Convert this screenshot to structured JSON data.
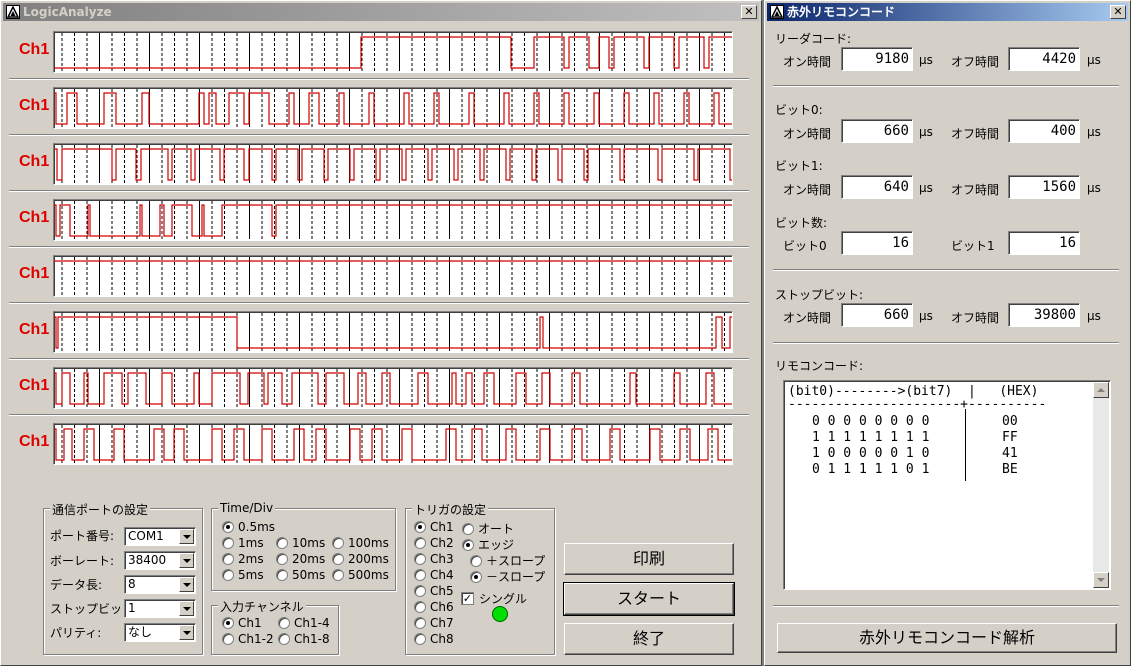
{
  "logic_window": {
    "title": "LogicAnalyze",
    "close_glyph": "✕",
    "channel_rows": [
      {
        "label": "Ch1",
        "edges": [
          0,
          307,
          457,
          480,
          510,
          515,
          535,
          545,
          555,
          560,
          590,
          595,
          620,
          625,
          650,
          655,
          680
        ]
      },
      {
        "label": "Ch1",
        "edges": [
          0,
          2,
          13,
          23,
          50,
          62,
          88,
          95,
          145,
          150,
          155,
          162,
          175,
          190,
          195,
          215,
          235,
          240,
          255,
          265,
          285,
          290,
          315,
          320,
          350,
          355,
          380,
          385,
          415,
          420,
          450,
          455,
          480,
          485,
          510,
          515,
          540,
          545,
          570,
          575,
          600,
          605,
          630,
          635,
          660,
          665,
          680
        ]
      },
      {
        "label": "Ch1",
        "edges": [
          0,
          3,
          8,
          58,
          62,
          82,
          87,
          114,
          118,
          137,
          141,
          166,
          170,
          190,
          195,
          218,
          222,
          244,
          248,
          270,
          274,
          296,
          300,
          322,
          326,
          348,
          352,
          374,
          378,
          400,
          404,
          426,
          430,
          452,
          456,
          478,
          482,
          504,
          508,
          530,
          534,
          566,
          570,
          604,
          608,
          640,
          644,
          676,
          680
        ]
      },
      {
        "label": "Ch1",
        "edges": [
          0,
          2,
          6,
          16,
          34,
          36,
          86,
          88,
          106,
          110,
          118,
          138,
          148,
          150,
          168,
          218,
          222,
          680
        ]
      },
      {
        "label": "Ch1",
        "edges": [
          0,
          680
        ]
      },
      {
        "label": "Ch1",
        "edges": [
          0,
          2,
          4,
          183,
          486,
          489,
          662,
          668,
          676,
          680
        ]
      },
      {
        "label": "Ch1",
        "edges": [
          0,
          2,
          8,
          16,
          30,
          34,
          50,
          68,
          74,
          92,
          108,
          118,
          140,
          145,
          158,
          186,
          194,
          210,
          214,
          228,
          238,
          264,
          272,
          290,
          304,
          312,
          328,
          336,
          364,
          374,
          398,
          402,
          412,
          418,
          430,
          440,
          462,
          472,
          488,
          496,
          518,
          526,
          576,
          582,
          620,
          626,
          652,
          660,
          680
        ]
      },
      {
        "label": "Ch1",
        "edges": [
          0,
          2,
          10,
          18,
          30,
          40,
          60,
          70,
          100,
          110,
          120,
          130,
          158,
          168,
          180,
          190,
          208,
          218,
          240,
          250,
          262,
          272,
          296,
          306,
          318,
          328,
          348,
          358,
          392,
          402,
          418,
          428,
          452,
          462,
          486,
          496,
          518,
          528,
          556,
          566,
          596,
          606,
          626,
          636,
          654,
          664,
          680
        ]
      }
    ],
    "port_settings": {
      "title": "通信ポートの設定",
      "port_label": "ポート番号:",
      "port_value": "COM1",
      "baud_label": "ボーレート:",
      "baud_value": "38400",
      "data_label": "データ長:",
      "data_value": "8",
      "stop_label": "ストップビット:",
      "stop_value": "1",
      "parity_label": "パリティ:",
      "parity_value": "なし"
    },
    "time_div": {
      "title": "Time/Div",
      "options": [
        "0.5ms",
        "1ms",
        "10ms",
        "100ms",
        "2ms",
        "20ms",
        "200ms",
        "5ms",
        "50ms",
        "500ms"
      ],
      "selected": "0.5ms"
    },
    "input_channel": {
      "title": "入力チャンネル",
      "options": [
        "Ch1",
        "Ch1-4",
        "Ch1-2",
        "Ch1-8"
      ],
      "selected": "Ch1"
    },
    "trigger": {
      "title": "トリガの設定",
      "channels": [
        "Ch1",
        "Ch2",
        "Ch3",
        "Ch4",
        "Ch5",
        "Ch6",
        "Ch7",
        "Ch8"
      ],
      "selected_channel": "Ch1",
      "auto_label": "オート",
      "edge_label": "エッジ",
      "mode_selected": "edge",
      "plus_slope_label": "＋スロープ",
      "minus_slope_label": "－スロープ",
      "slope_selected": "minus",
      "single_label": "シングル",
      "single_checked": true,
      "indicator_color": "#00e000"
    },
    "buttons": {
      "print": "印刷",
      "start": "スタート",
      "end": "終了"
    }
  },
  "remote_window": {
    "title": "赤外リモコンコード",
    "close_glyph": "✕",
    "leader": {
      "title": "リーダコード:",
      "on_label": "オン時間",
      "on_value": "9180",
      "off_label": "オフ時間",
      "off_value": "4420",
      "unit": "μs"
    },
    "bit0": {
      "title": "ビット0:",
      "on_label": "オン時間",
      "on_value": "660",
      "off_label": "オフ時間",
      "off_value": "400",
      "unit": "μs"
    },
    "bit1": {
      "title": "ビット1:",
      "on_label": "オン時間",
      "on_value": "640",
      "off_label": "オフ時間",
      "off_value": "1560",
      "unit": "μs"
    },
    "bitcount": {
      "title": "ビット数:",
      "bit0_label": "ビット0",
      "bit0_value": "16",
      "bit1_label": "ビット1",
      "bit1_value": "16"
    },
    "stopbit": {
      "title": "ストップビット:",
      "on_label": "オン時間",
      "on_value": "660",
      "off_label": "オフ時間",
      "off_value": "39800",
      "unit": "μs"
    },
    "remote_code": {
      "title": "リモコンコード:",
      "header": "(bit0)-------->(bit7)  |   (HEX)",
      "divider": "----------------------+----------",
      "rows": [
        {
          "bits": "0 0 0 0 0 0 0 0",
          "hex": "00"
        },
        {
          "bits": "1 1 1 1 1 1 1 1",
          "hex": "FF"
        },
        {
          "bits": "1 0 0 0 0 0 1 0",
          "hex": "41"
        },
        {
          "bits": "0 1 1 1 1 1 0 1",
          "hex": "BE"
        }
      ]
    },
    "analyze_button": "赤外リモコンコード解析"
  }
}
